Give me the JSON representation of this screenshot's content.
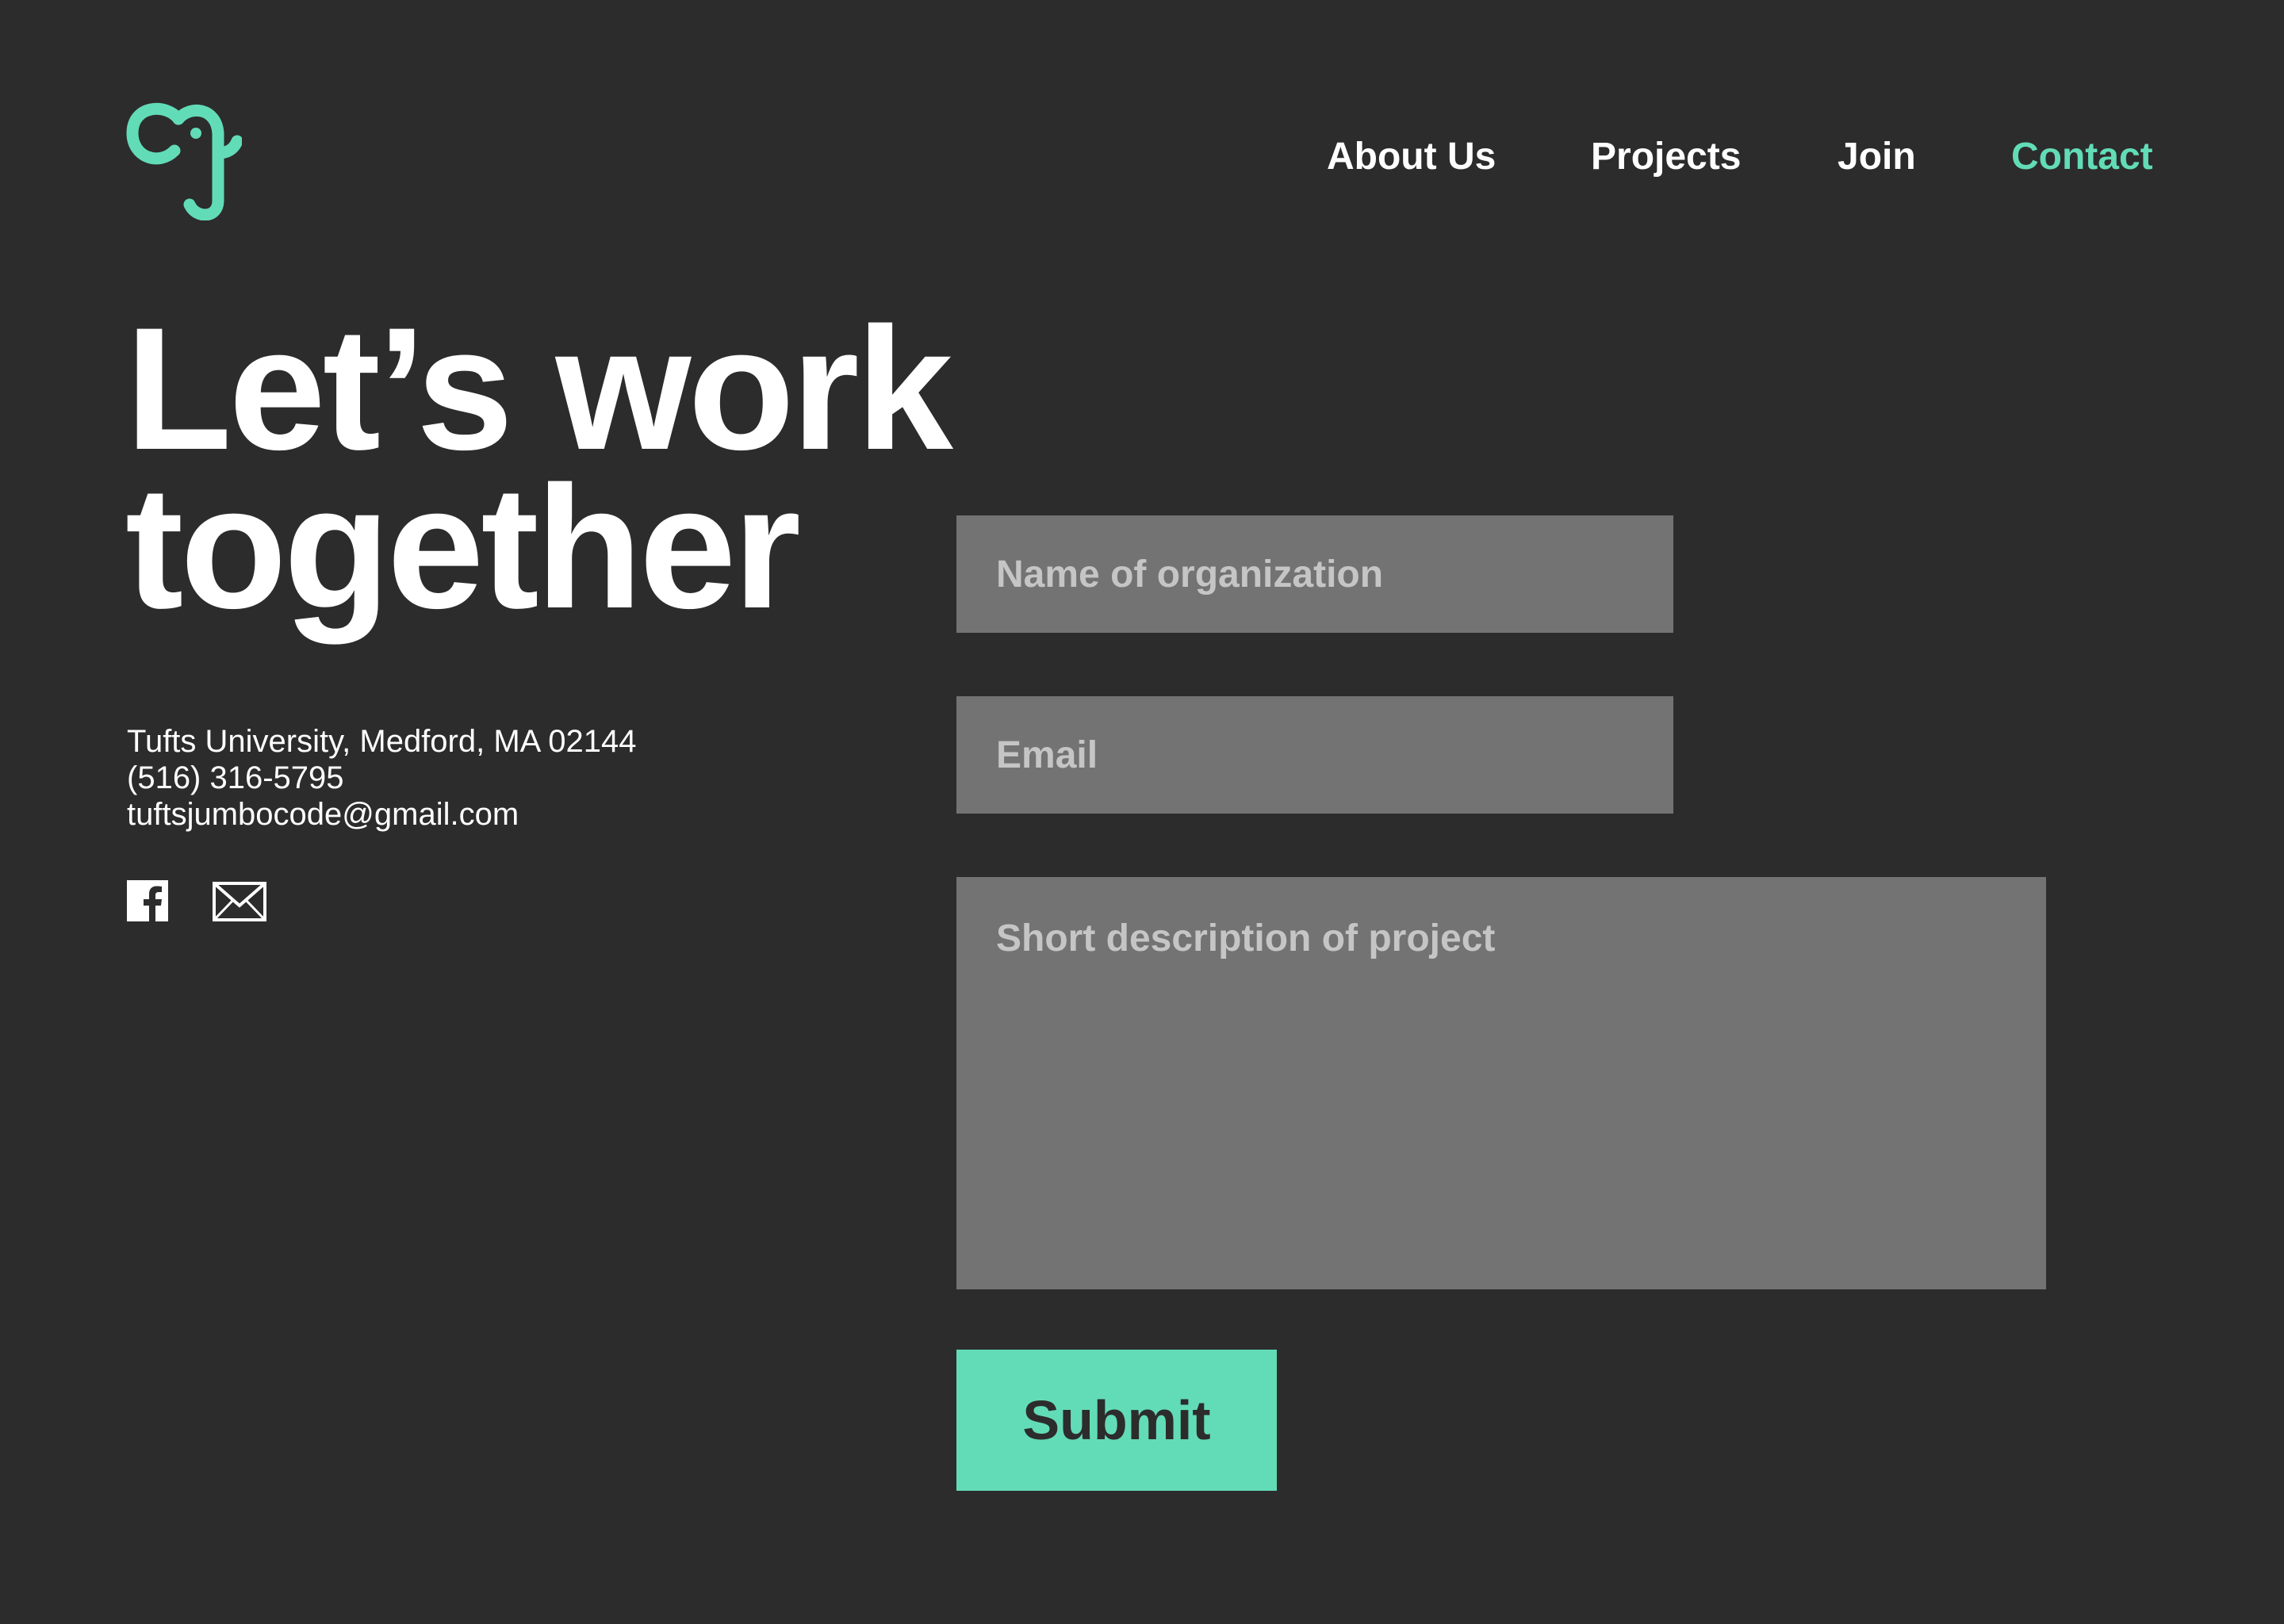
{
  "brand": {
    "logo_icon": "elephant-logo-icon",
    "accent_color": "#62dcb6",
    "background_color": "#2c2c2c"
  },
  "nav": {
    "items": [
      {
        "label": "About Us",
        "active": false
      },
      {
        "label": "Projects",
        "active": false
      },
      {
        "label": "Join",
        "active": false
      },
      {
        "label": "Contact",
        "active": true
      }
    ]
  },
  "hero": {
    "line1": "Let’s work",
    "line2": "together"
  },
  "contact": {
    "address": "Tufts University, Medford, MA 02144",
    "phone": "(516) 316-5795",
    "email": "tuftsjumbocode@gmail.com"
  },
  "social": {
    "icons": [
      "facebook-icon",
      "mail-icon"
    ]
  },
  "form": {
    "organization": {
      "placeholder": "Name of organization",
      "value": ""
    },
    "email": {
      "placeholder": "Email",
      "value": ""
    },
    "description": {
      "placeholder": "Short description of project",
      "value": ""
    },
    "submit_label": "Submit",
    "field_color": "#737373",
    "placeholder_color": "#c5c5c5"
  }
}
